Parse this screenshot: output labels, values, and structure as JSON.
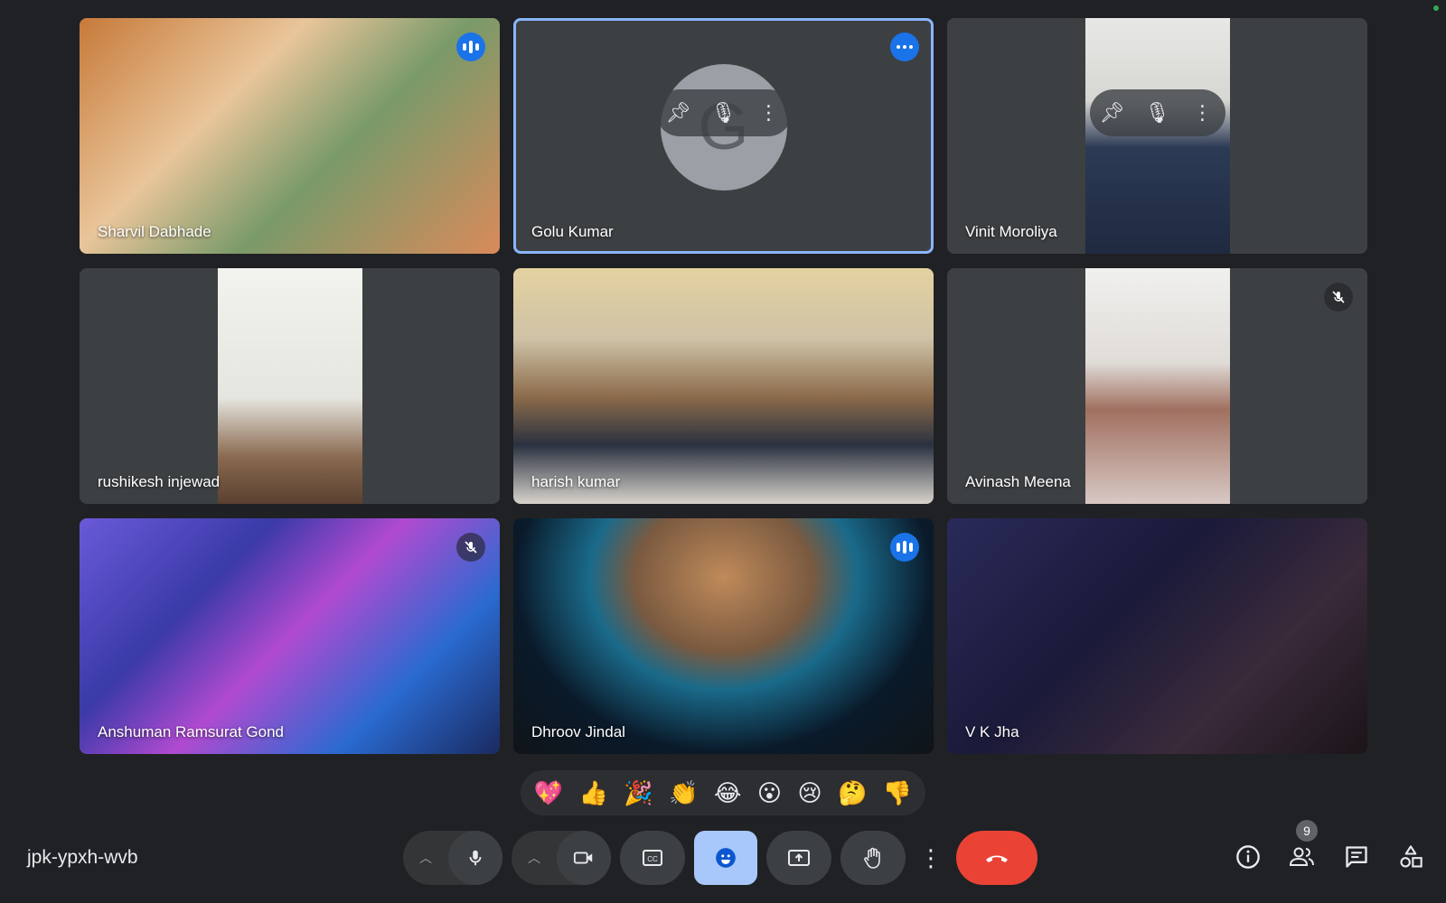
{
  "meeting": {
    "code": "jpk-ypxh-wvb",
    "participant_count": "9"
  },
  "tiles": [
    {
      "name": "Sharvil Dabhade",
      "indicator": "speaking"
    },
    {
      "name": "Golu Kumar",
      "indicator": "more-options",
      "avatar_letter": "G"
    },
    {
      "name": "Vinit Moroliya",
      "indicator": "none"
    },
    {
      "name": "rushikesh injewad",
      "indicator": "none"
    },
    {
      "name": "harish kumar",
      "indicator": "none"
    },
    {
      "name": "Avinash Meena",
      "indicator": "muted"
    },
    {
      "name": "Anshuman Ramsurat Gond",
      "indicator": "muted"
    },
    {
      "name": "Dhroov Jindal",
      "indicator": "speaking"
    },
    {
      "name": "V K Jha",
      "indicator": "none"
    }
  ],
  "reactions": [
    "💖",
    "👍",
    "🎉",
    "👏",
    "😂",
    "😮",
    "😢",
    "🤔",
    "👎"
  ],
  "colors": {
    "background": "#202124",
    "tile": "#3c4043",
    "accent": "#8ab4f8",
    "end_call": "#ea4335",
    "reaction_active": "#a8c7fa"
  }
}
